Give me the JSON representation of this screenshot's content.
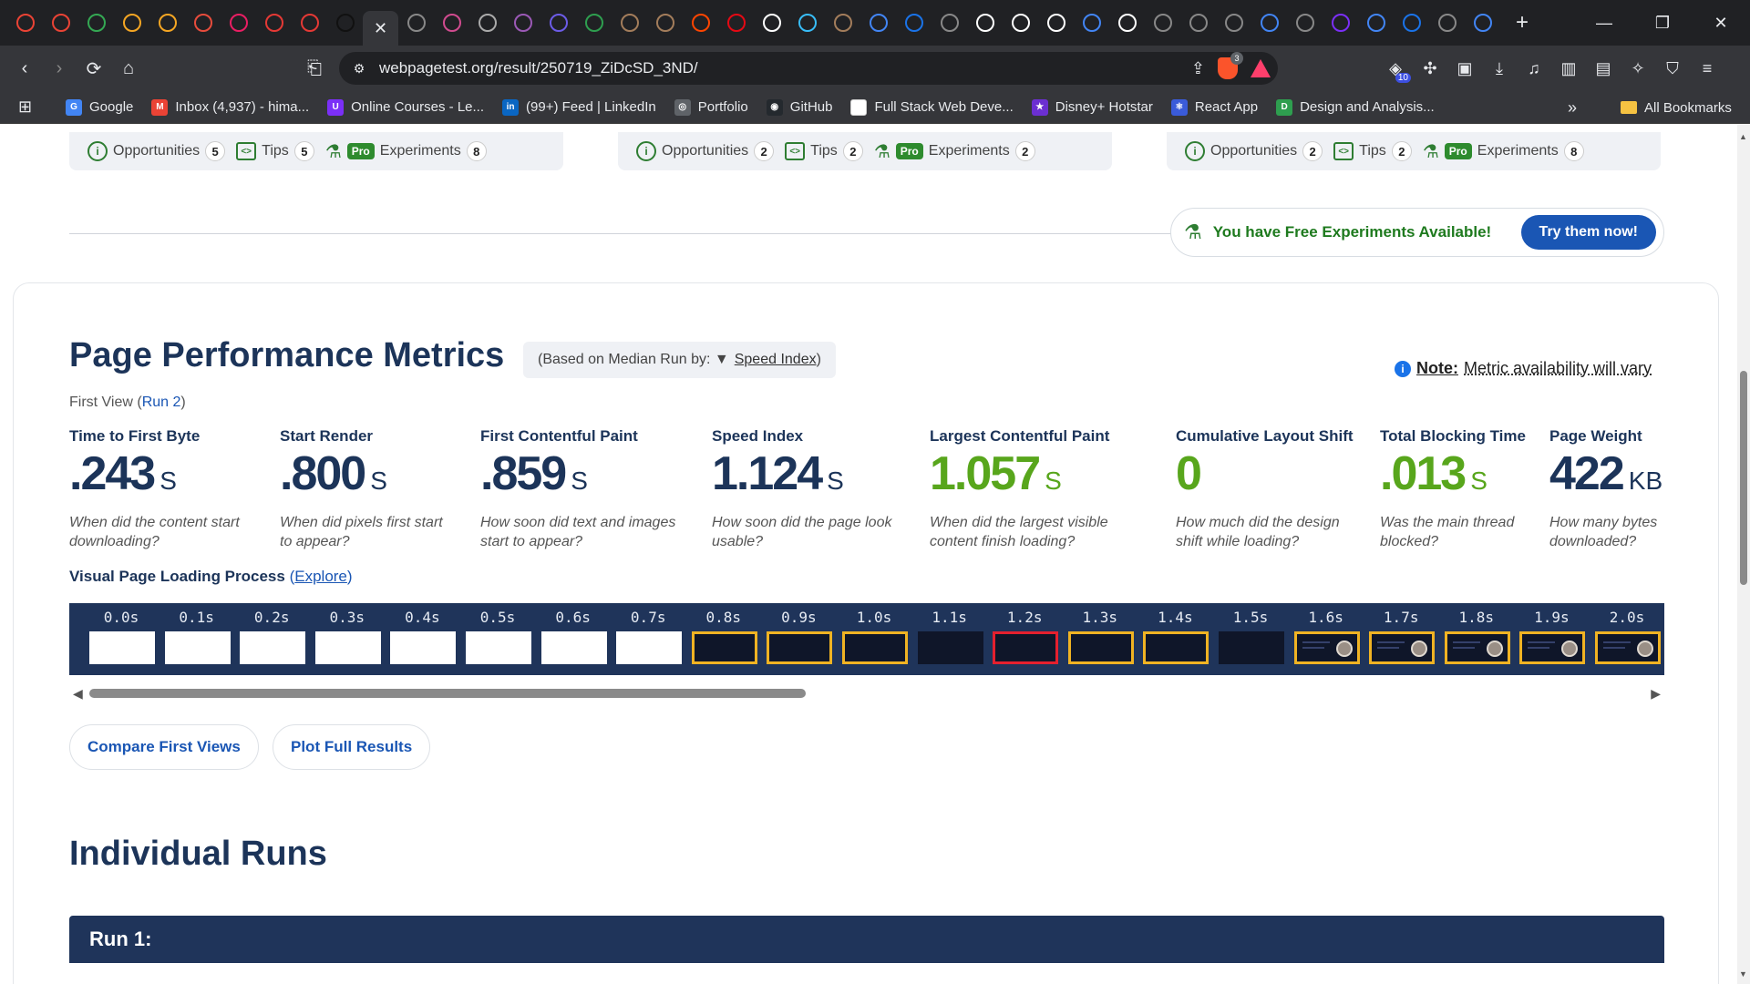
{
  "browser": {
    "url": "webpagetest.org/result/250719_ZiDcSD_3ND/",
    "extension_badge": "10",
    "shield_count": "3",
    "bookmarks": [
      {
        "label": "Google",
        "color": "#4285f4",
        "glyph": "G"
      },
      {
        "label": "Inbox (4,937) - hima...",
        "color": "#ea4335",
        "glyph": "M"
      },
      {
        "label": "Online Courses - Le...",
        "color": "#7b2ff7",
        "glyph": "U"
      },
      {
        "label": "(99+) Feed | LinkedIn",
        "color": "#0a66c2",
        "glyph": "in"
      },
      {
        "label": "Portfolio",
        "color": "#5f6368",
        "glyph": "◎"
      },
      {
        "label": "GitHub",
        "color": "#24292e",
        "glyph": "◉"
      },
      {
        "label": "Full Stack Web Deve...",
        "color": "#ffffff",
        "glyph": ""
      },
      {
        "label": "Disney+ Hotstar",
        "color": "#6b2fd1",
        "glyph": "★"
      },
      {
        "label": "React App",
        "color": "#3a5bd9",
        "glyph": "⚛"
      },
      {
        "label": "Design and Analysis...",
        "color": "#2e9e4f",
        "glyph": "D"
      }
    ],
    "all_bookmarks_label": "All Bookmarks"
  },
  "summary_cards": [
    {
      "opportunities_label": "Opportunities",
      "opportunities": "5",
      "tips_label": "Tips",
      "tips": "5",
      "pro_label": "Pro",
      "experiments_label": "Experiments",
      "experiments": "8"
    },
    {
      "opportunities_label": "Opportunities",
      "opportunities": "2",
      "tips_label": "Tips",
      "tips": "2",
      "pro_label": "Pro",
      "experiments_label": "Experiments",
      "experiments": "2"
    },
    {
      "opportunities_label": "Opportunities",
      "opportunities": "2",
      "tips_label": "Tips",
      "tips": "2",
      "pro_label": "Pro",
      "experiments_label": "Experiments",
      "experiments": "8"
    }
  ],
  "free_experiments": {
    "text": "You have Free Experiments Available!",
    "button": "Try them now!"
  },
  "metrics_section": {
    "title": "Page Performance Metrics",
    "median_prefix": "(Based on Median Run by: ▼",
    "median_link": "Speed Index",
    "median_suffix": ")",
    "note_bold": "Note:",
    "note_text": "Metric availability will vary",
    "first_view_prefix": "First View (",
    "first_view_run": "Run 2",
    "first_view_suffix": ")",
    "metrics": [
      {
        "label": "Time to First Byte",
        "value": ".243",
        "unit": "S",
        "desc1": "When did the content start",
        "desc2": "downloading?",
        "green": false
      },
      {
        "label": "Start Render",
        "value": ".800",
        "unit": "S",
        "desc1": "When did pixels first start",
        "desc2": "to appear?",
        "green": false
      },
      {
        "label": "First Contentful Paint",
        "value": ".859",
        "unit": "S",
        "desc1": "How soon did text and images",
        "desc2": "start to appear?",
        "green": false
      },
      {
        "label": "Speed Index",
        "value": "1.124",
        "unit": "S",
        "desc1": "How soon did the page look",
        "desc2": "usable?",
        "green": false
      },
      {
        "label": "Largest Contentful Paint",
        "value": "1.057",
        "unit": "S",
        "desc1": "When did the largest visible",
        "desc2": "content finish loading?",
        "green": true
      },
      {
        "label": "Cumulative Layout Shift",
        "value": "0",
        "unit": "",
        "desc1": "How much did the design",
        "desc2": "shift while loading?",
        "green": true
      },
      {
        "label": "Total Blocking Time",
        "value": ".013",
        "unit": "S",
        "desc1": "Was the main thread",
        "desc2": "blocked?",
        "green": true
      },
      {
        "label": "Page Weight",
        "value": "422",
        "unit": "KB",
        "desc1": "How many bytes",
        "desc2": "downloaded?",
        "green": false
      }
    ]
  },
  "visual_loading": {
    "title": "Visual Page Loading Process",
    "explore_open": "(",
    "explore_link": "Explore",
    "explore_close": ")",
    "frames": [
      {
        "time": "0.0s",
        "state": "white"
      },
      {
        "time": "0.1s",
        "state": "white"
      },
      {
        "time": "0.2s",
        "state": "white"
      },
      {
        "time": "0.3s",
        "state": "white"
      },
      {
        "time": "0.4s",
        "state": "white"
      },
      {
        "time": "0.5s",
        "state": "white"
      },
      {
        "time": "0.6s",
        "state": "white"
      },
      {
        "time": "0.7s",
        "state": "white"
      },
      {
        "time": "0.8s",
        "state": "dark-yellow"
      },
      {
        "time": "0.9s",
        "state": "dark-yellow"
      },
      {
        "time": "1.0s",
        "state": "dark-yellow"
      },
      {
        "time": "1.1s",
        "state": "dark"
      },
      {
        "time": "1.2s",
        "state": "dark-red"
      },
      {
        "time": "1.3s",
        "state": "dark-yellow"
      },
      {
        "time": "1.4s",
        "state": "dark-yellow"
      },
      {
        "time": "1.5s",
        "state": "dark"
      },
      {
        "time": "1.6s",
        "state": "avatar-yellow"
      },
      {
        "time": "1.7s",
        "state": "avatar-yellow"
      },
      {
        "time": "1.8s",
        "state": "avatar-yellow"
      },
      {
        "time": "1.9s",
        "state": "avatar-yellow"
      },
      {
        "time": "2.0s",
        "state": "avatar-yellow"
      }
    ]
  },
  "actions": {
    "compare": "Compare First Views",
    "plot": "Plot Full Results"
  },
  "individual_runs": {
    "title": "Individual Runs",
    "run1": "Run 1:"
  },
  "colors": {
    "navy": "#1c3459",
    "green": "#58a61c",
    "link": "#1a56b4",
    "filmstrip_bg": "#1f345a",
    "frame_yellow": "#f0b323",
    "frame_red": "#e5202e"
  }
}
